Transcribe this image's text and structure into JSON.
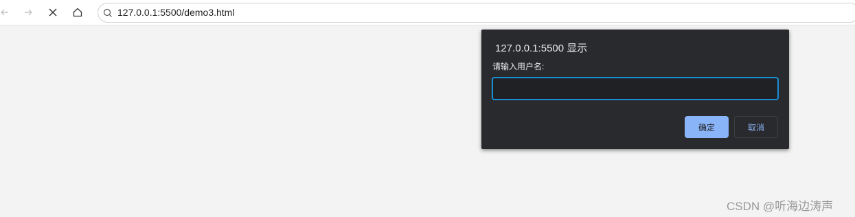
{
  "browser": {
    "url": "127.0.0.1:5500/demo3.html",
    "icons": [
      "back-arrow-icon",
      "forward-arrow-icon",
      "close-icon",
      "home-icon",
      "search-icon"
    ]
  },
  "dialog": {
    "title": "127.0.0.1:5500 显示",
    "message": "请输入用户名:",
    "input_value": "",
    "ok_label": "确定",
    "cancel_label": "取消"
  },
  "watermark": {
    "text": "CSDN @听海边涛声"
  },
  "colors": {
    "page_background": "#f3f3f3",
    "dialog_background": "#292a2d",
    "input_border": "#1a8fd6",
    "ok_button": "#8ab4f8",
    "cancel_text": "#8ab4f8"
  }
}
